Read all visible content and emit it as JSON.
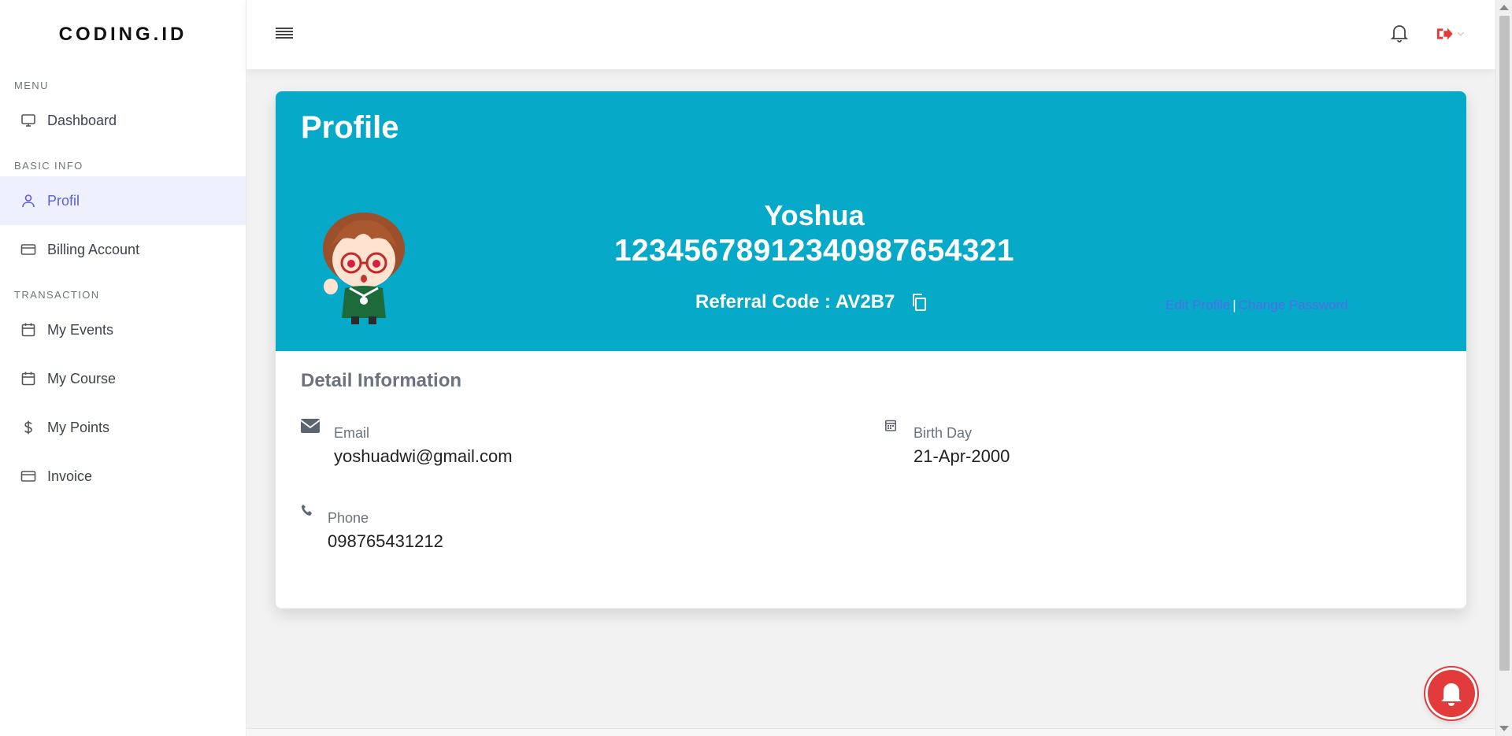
{
  "brand": "CODING.ID",
  "sidebar": {
    "sections": [
      {
        "label": "MENU",
        "items": [
          {
            "label": "Dashboard",
            "icon": "monitor-icon"
          }
        ]
      },
      {
        "label": "BASIC INFO",
        "items": [
          {
            "label": "Profil",
            "icon": "user-icon",
            "active": true
          },
          {
            "label": "Billing Account",
            "icon": "credit-card-icon"
          }
        ]
      },
      {
        "label": "TRANSACTION",
        "items": [
          {
            "label": "My Events",
            "icon": "calendar-icon"
          },
          {
            "label": "My Course",
            "icon": "calendar-icon"
          },
          {
            "label": "My Points",
            "icon": "dollar-icon"
          },
          {
            "label": "Invoice",
            "icon": "credit-card-icon"
          }
        ]
      }
    ]
  },
  "topbar": {
    "menu_icon": "hamburger-icon",
    "notification_icon": "bell-icon",
    "logout_icon": "sign-out-icon"
  },
  "profile": {
    "title": "Profile",
    "name": "Yoshua",
    "id_number": "12345678912340987654321",
    "referral_label": "Referral Code : AV2B7",
    "edit_profile": "Edit Profile",
    "separator": "|",
    "change_password": "Change Password"
  },
  "detail": {
    "title": "Detail Information",
    "email_label": "Email",
    "email_value": "yoshuadwi@gmail.com",
    "birthday_label": "Birth Day",
    "birthday_value": "21-Apr-2000",
    "phone_label": "Phone",
    "phone_value": "098765431212"
  },
  "colors": {
    "accent": "#07a9c9",
    "active_nav": "#5a5fe0",
    "active_nav_bg": "#eef0fd",
    "fab": "#e23b3b",
    "link": "#4b6fe8"
  }
}
